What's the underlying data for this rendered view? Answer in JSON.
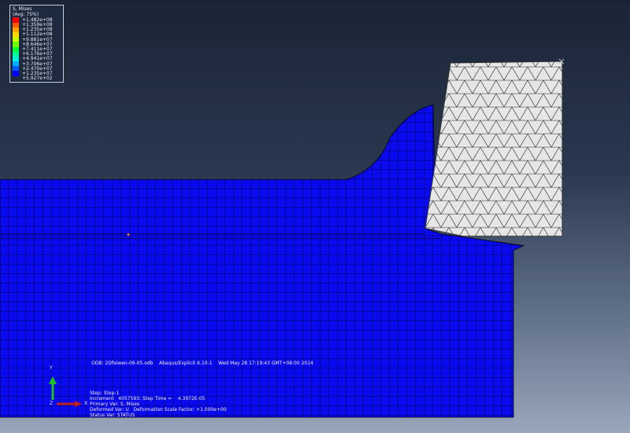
{
  "legend": {
    "title": "S, Mises",
    "subtitle": "(Avg: 75%)",
    "values": [
      "+1.482e+08",
      "+1.359e+08",
      "+1.235e+08",
      "+1.112e+08",
      "+9.881e+07",
      "+8.646e+07",
      "+7.411e+07",
      "+6.176e+07",
      "+4.941e+07",
      "+3.706e+07",
      "+2.470e+07",
      "+1.235e+07",
      "+5.927e+02"
    ],
    "colors": [
      "#ff0000",
      "#ff5a00",
      "#ffa500",
      "#ffd700",
      "#c8ff00",
      "#6eff00",
      "#00ff32",
      "#00ff96",
      "#00f0dc",
      "#00aaff",
      "#005aff",
      "#0000ff"
    ]
  },
  "info": {
    "odb": "ODB: 2Dfeiwen-06-05.odb    Abaqus/Explicit 6.10-1    Wed May 28 17:19:43 GMT+08:00 2014",
    "step": "Step: Step-1",
    "increment": "Increment   4057593: Step Time =    4.3972E-05",
    "primary": "Primary Var: S, Mises",
    "deformed": "Deformed Var: U   Deformation Scale Factor: +1.000e+00",
    "status": "Status Var: STATUS"
  },
  "triad": {
    "y": "Y",
    "x": "X",
    "z": "Z"
  },
  "colors": {
    "mesh": "#0a0aee",
    "tool": "#e6e6e6"
  }
}
